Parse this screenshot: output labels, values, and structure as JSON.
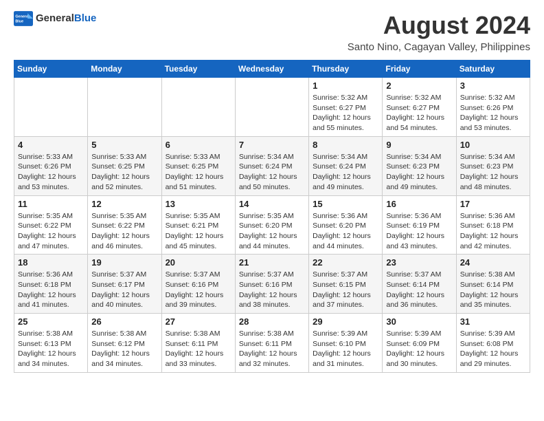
{
  "logo": {
    "text_general": "General",
    "text_blue": "Blue"
  },
  "header": {
    "month_year": "August 2024",
    "location": "Santo Nino, Cagayan Valley, Philippines"
  },
  "weekdays": [
    "Sunday",
    "Monday",
    "Tuesday",
    "Wednesday",
    "Thursday",
    "Friday",
    "Saturday"
  ],
  "weeks": [
    [
      {
        "day": "",
        "text": ""
      },
      {
        "day": "",
        "text": ""
      },
      {
        "day": "",
        "text": ""
      },
      {
        "day": "",
        "text": ""
      },
      {
        "day": "1",
        "text": "Sunrise: 5:32 AM\nSunset: 6:27 PM\nDaylight: 12 hours\nand 55 minutes."
      },
      {
        "day": "2",
        "text": "Sunrise: 5:32 AM\nSunset: 6:27 PM\nDaylight: 12 hours\nand 54 minutes."
      },
      {
        "day": "3",
        "text": "Sunrise: 5:32 AM\nSunset: 6:26 PM\nDaylight: 12 hours\nand 53 minutes."
      }
    ],
    [
      {
        "day": "4",
        "text": "Sunrise: 5:33 AM\nSunset: 6:26 PM\nDaylight: 12 hours\nand 53 minutes."
      },
      {
        "day": "5",
        "text": "Sunrise: 5:33 AM\nSunset: 6:25 PM\nDaylight: 12 hours\nand 52 minutes."
      },
      {
        "day": "6",
        "text": "Sunrise: 5:33 AM\nSunset: 6:25 PM\nDaylight: 12 hours\nand 51 minutes."
      },
      {
        "day": "7",
        "text": "Sunrise: 5:34 AM\nSunset: 6:24 PM\nDaylight: 12 hours\nand 50 minutes."
      },
      {
        "day": "8",
        "text": "Sunrise: 5:34 AM\nSunset: 6:24 PM\nDaylight: 12 hours\nand 49 minutes."
      },
      {
        "day": "9",
        "text": "Sunrise: 5:34 AM\nSunset: 6:23 PM\nDaylight: 12 hours\nand 49 minutes."
      },
      {
        "day": "10",
        "text": "Sunrise: 5:34 AM\nSunset: 6:23 PM\nDaylight: 12 hours\nand 48 minutes."
      }
    ],
    [
      {
        "day": "11",
        "text": "Sunrise: 5:35 AM\nSunset: 6:22 PM\nDaylight: 12 hours\nand 47 minutes."
      },
      {
        "day": "12",
        "text": "Sunrise: 5:35 AM\nSunset: 6:22 PM\nDaylight: 12 hours\nand 46 minutes."
      },
      {
        "day": "13",
        "text": "Sunrise: 5:35 AM\nSunset: 6:21 PM\nDaylight: 12 hours\nand 45 minutes."
      },
      {
        "day": "14",
        "text": "Sunrise: 5:35 AM\nSunset: 6:20 PM\nDaylight: 12 hours\nand 44 minutes."
      },
      {
        "day": "15",
        "text": "Sunrise: 5:36 AM\nSunset: 6:20 PM\nDaylight: 12 hours\nand 44 minutes."
      },
      {
        "day": "16",
        "text": "Sunrise: 5:36 AM\nSunset: 6:19 PM\nDaylight: 12 hours\nand 43 minutes."
      },
      {
        "day": "17",
        "text": "Sunrise: 5:36 AM\nSunset: 6:18 PM\nDaylight: 12 hours\nand 42 minutes."
      }
    ],
    [
      {
        "day": "18",
        "text": "Sunrise: 5:36 AM\nSunset: 6:18 PM\nDaylight: 12 hours\nand 41 minutes."
      },
      {
        "day": "19",
        "text": "Sunrise: 5:37 AM\nSunset: 6:17 PM\nDaylight: 12 hours\nand 40 minutes."
      },
      {
        "day": "20",
        "text": "Sunrise: 5:37 AM\nSunset: 6:16 PM\nDaylight: 12 hours\nand 39 minutes."
      },
      {
        "day": "21",
        "text": "Sunrise: 5:37 AM\nSunset: 6:16 PM\nDaylight: 12 hours\nand 38 minutes."
      },
      {
        "day": "22",
        "text": "Sunrise: 5:37 AM\nSunset: 6:15 PM\nDaylight: 12 hours\nand 37 minutes."
      },
      {
        "day": "23",
        "text": "Sunrise: 5:37 AM\nSunset: 6:14 PM\nDaylight: 12 hours\nand 36 minutes."
      },
      {
        "day": "24",
        "text": "Sunrise: 5:38 AM\nSunset: 6:14 PM\nDaylight: 12 hours\nand 35 minutes."
      }
    ],
    [
      {
        "day": "25",
        "text": "Sunrise: 5:38 AM\nSunset: 6:13 PM\nDaylight: 12 hours\nand 34 minutes."
      },
      {
        "day": "26",
        "text": "Sunrise: 5:38 AM\nSunset: 6:12 PM\nDaylight: 12 hours\nand 34 minutes."
      },
      {
        "day": "27",
        "text": "Sunrise: 5:38 AM\nSunset: 6:11 PM\nDaylight: 12 hours\nand 33 minutes."
      },
      {
        "day": "28",
        "text": "Sunrise: 5:38 AM\nSunset: 6:11 PM\nDaylight: 12 hours\nand 32 minutes."
      },
      {
        "day": "29",
        "text": "Sunrise: 5:39 AM\nSunset: 6:10 PM\nDaylight: 12 hours\nand 31 minutes."
      },
      {
        "day": "30",
        "text": "Sunrise: 5:39 AM\nSunset: 6:09 PM\nDaylight: 12 hours\nand 30 minutes."
      },
      {
        "day": "31",
        "text": "Sunrise: 5:39 AM\nSunset: 6:08 PM\nDaylight: 12 hours\nand 29 minutes."
      }
    ]
  ]
}
